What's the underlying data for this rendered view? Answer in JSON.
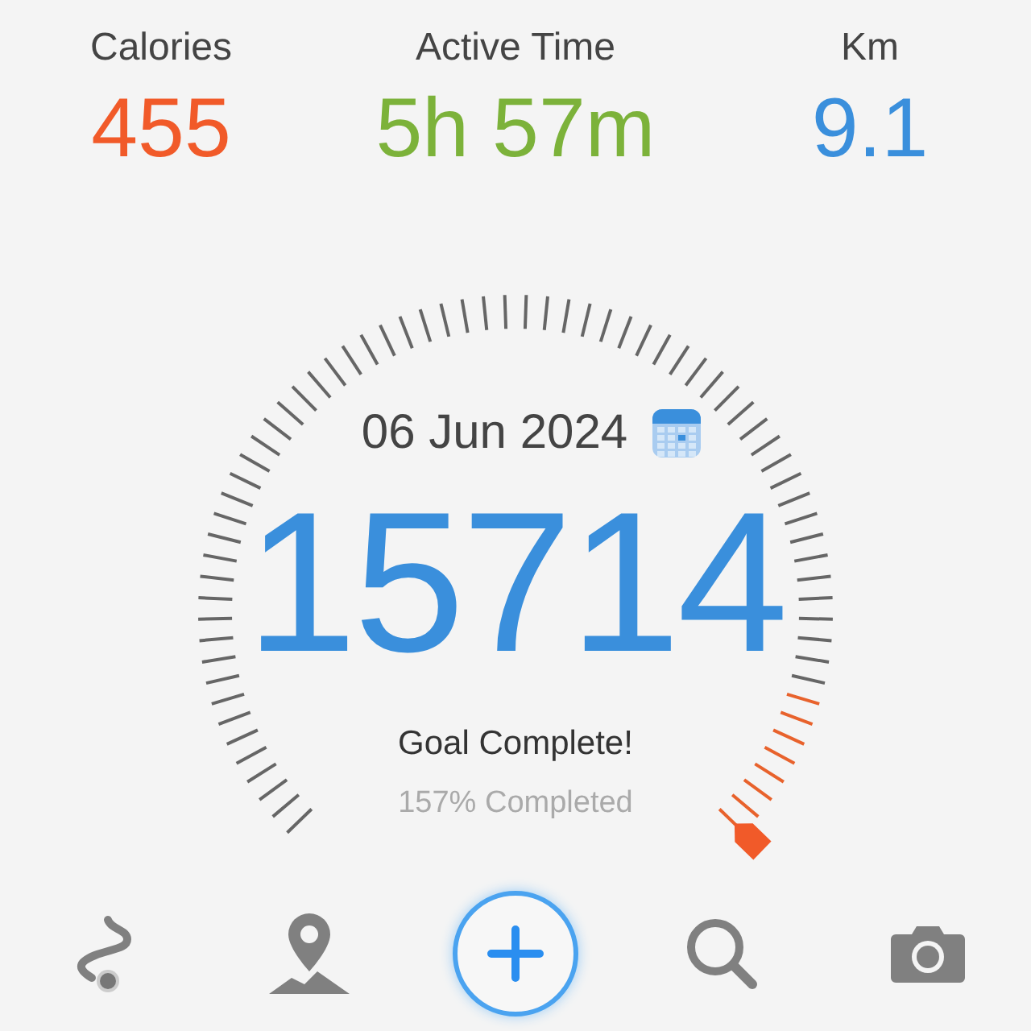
{
  "stats": [
    {
      "label": "Calories",
      "value": "455",
      "color": "#f15a29"
    },
    {
      "label": "Active Time",
      "value": "5h 57m",
      "color": "#7cb23a"
    },
    {
      "label": "Km",
      "value": "9.1",
      "color": "#3a8fdc"
    }
  ],
  "gauge": {
    "date": "06 Jun 2024",
    "steps": "15714",
    "status": "Goal Complete!",
    "percent": "157% Completed"
  },
  "nav": [
    {
      "kind": "route"
    },
    {
      "kind": "map"
    },
    {
      "kind": "add"
    },
    {
      "kind": "search"
    },
    {
      "kind": "camera"
    }
  ]
}
